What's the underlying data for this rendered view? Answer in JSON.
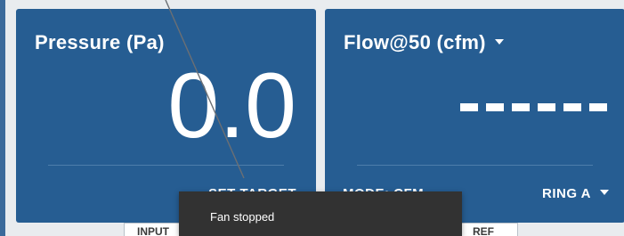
{
  "colors": {
    "panel": "#265d92",
    "toast": "#323232",
    "background": "#e9ecef"
  },
  "pressure_panel": {
    "title": "Pressure (Pa)",
    "value": "0.0",
    "bottom_label": "SET TARGET"
  },
  "flow_panel": {
    "title": "Flow@50 (cfm)",
    "value_placeholder": "------",
    "bottom_left_label": "MODE: CFM",
    "ring_selector": "RING A"
  },
  "tabs": {
    "input": "INPUT",
    "ref": "REF"
  },
  "toast": {
    "message": "Fan stopped"
  }
}
